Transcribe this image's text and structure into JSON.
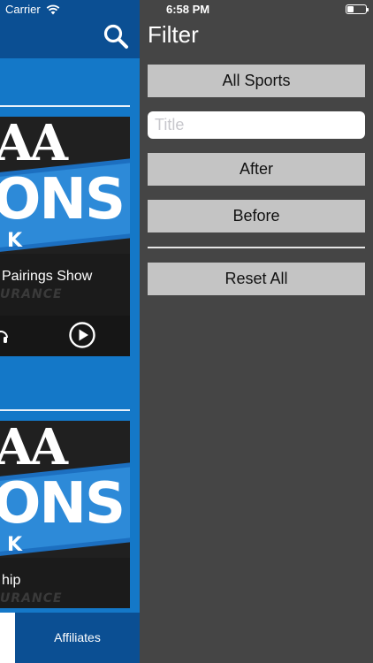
{
  "status_bar": {
    "carrier": "Carrier",
    "time": "6:58 PM",
    "battery_level": 0.35
  },
  "main": {
    "cards": [
      {
        "art_top": "AA",
        "art_main": "ONS",
        "art_sub": "K",
        "caption": "Pairings Show",
        "caption_ghost": "URANCE"
      },
      {
        "art_top": "AA",
        "art_main": "ONS",
        "art_sub": "K",
        "caption": "hip",
        "caption_ghost": "URANCE"
      }
    ],
    "bottom_tab": {
      "label": "Affiliates"
    }
  },
  "filter": {
    "title": "Filter",
    "sports_label": "All Sports",
    "title_placeholder": "Title",
    "after_label": "After",
    "before_label": "Before",
    "reset_label": "Reset All"
  },
  "icons": {
    "search": "search-icon",
    "wifi": "wifi-icon",
    "headphones": "headphones-icon",
    "play": "play-icon",
    "battery": "battery-icon"
  },
  "colors": {
    "header_blue": "#0b4f93",
    "main_blue": "#1478c8",
    "panel_gray": "#454545",
    "button_gray": "#c4c4c4"
  }
}
